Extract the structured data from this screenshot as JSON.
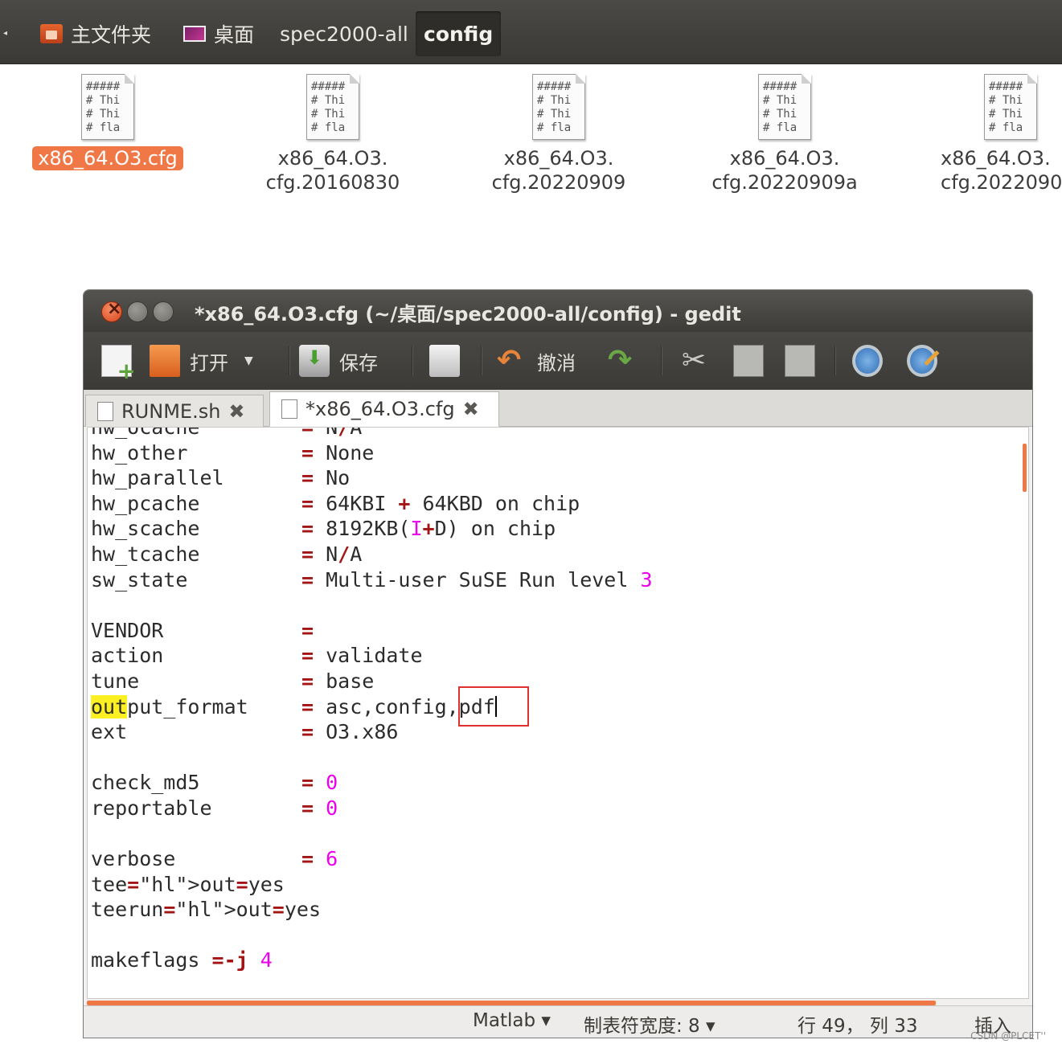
{
  "breadcrumb": {
    "items": [
      {
        "label": "主文件夹",
        "icon": "home-folder-icon"
      },
      {
        "label": "桌面",
        "icon": "desktop-icon"
      },
      {
        "label": "spec2000-all"
      },
      {
        "label": "config"
      }
    ]
  },
  "files": [
    {
      "line1": "x86_64.O3.cfg",
      "line2": "",
      "selected": true
    },
    {
      "line1": "x86_64.O3.",
      "line2": "cfg.20160830"
    },
    {
      "line1": "x86_64.O3.",
      "line2": "cfg.20220909"
    },
    {
      "line1": "x86_64.O3.",
      "line2": "cfg.20220909a"
    },
    {
      "line1": "x86_64.O3.",
      "line2": "cfg.2022090"
    }
  ],
  "doc_preview": "#####\n# Thi\n# Thi\n# fla",
  "gedit": {
    "title": "*x86_64.O3.cfg (~/桌面/spec2000-all/config) - gedit",
    "toolbar": {
      "open": "打开",
      "save": "保存",
      "undo": "撤消"
    },
    "tabs": [
      {
        "label": "RUNME.sh",
        "close": "✖"
      },
      {
        "label": "*x86_64.O3.cfg",
        "close": "✖"
      }
    ],
    "lines": [
      {
        "key": "hw_ocache",
        "op": "=",
        "val": "N/A"
      },
      {
        "key": "hw_other",
        "op": "=",
        "val": "None"
      },
      {
        "key": "hw_parallel",
        "op": "=",
        "val": "No"
      },
      {
        "key": "hw_pcache",
        "op": "=",
        "val": "64KBI + 64KBD on chip"
      },
      {
        "key": "hw_scache",
        "op": "=",
        "val": "8192KB(I+D) on chip"
      },
      {
        "key": "hw_tcache",
        "op": "=",
        "val": "N/A"
      },
      {
        "key": "sw_state",
        "op": "=",
        "val": "Multi-user SuSE Run level 3"
      },
      {
        "key": "",
        "op": "",
        "val": ""
      },
      {
        "key": "VENDOR",
        "op": "=",
        "val": ""
      },
      {
        "key": "action",
        "op": "=",
        "val": "validate"
      },
      {
        "key": "tune",
        "op": "=",
        "val": "base"
      },
      {
        "key": "output_format",
        "op": "=",
        "val": "asc,config,pdf"
      },
      {
        "key": "ext",
        "op": "=",
        "val": "O3.x86"
      },
      {
        "key": "",
        "op": "",
        "val": ""
      },
      {
        "key": "check_md5",
        "op": "=",
        "val": "0"
      },
      {
        "key": "reportable",
        "op": "=",
        "val": "0"
      },
      {
        "key": "",
        "op": "",
        "val": ""
      },
      {
        "key": "verbose",
        "op": "=",
        "val": "6"
      },
      {
        "raw": "teeout=yes"
      },
      {
        "raw": "teerunout=yes"
      },
      {
        "key": "",
        "op": "",
        "val": ""
      },
      {
        "raw": "makeflags =-j 4"
      }
    ],
    "status": {
      "language": "Matlab",
      "tab_width": "制表符宽度: 8",
      "position": "行 49， 列 33",
      "mode": "插入"
    }
  },
  "watermark": "CSDN @PLCET''",
  "colors": {
    "accent": "#f07746",
    "highlight": "#fcef22",
    "number": "#ee00ee",
    "operator": "#a31515"
  }
}
